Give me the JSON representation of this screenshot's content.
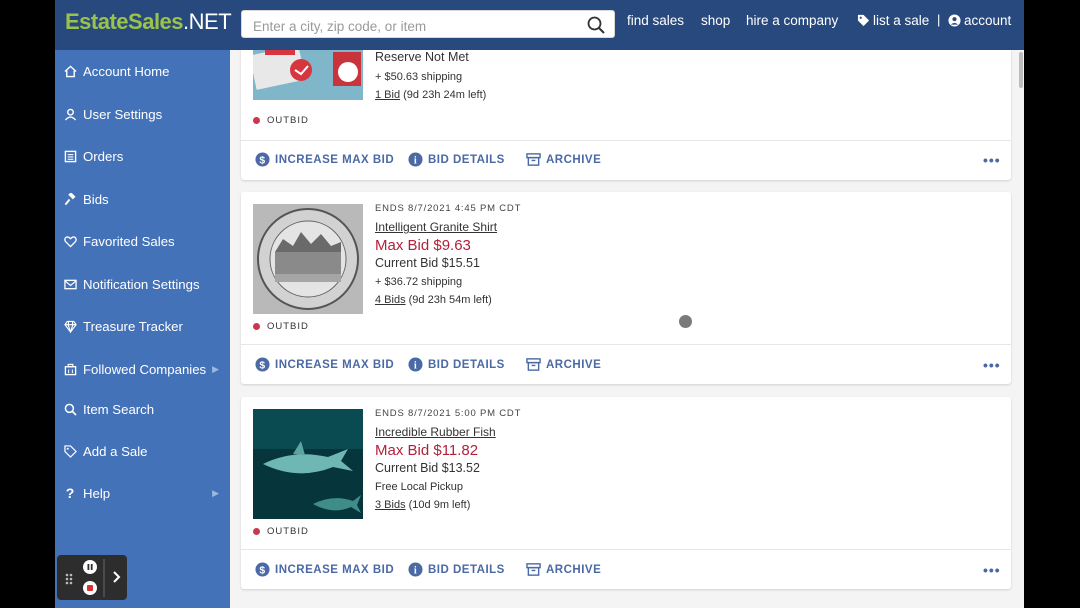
{
  "logo": {
    "part1": "EstateSales",
    "part2": ".NET"
  },
  "search": {
    "placeholder": "Enter a city, zip code, or item"
  },
  "nav": {
    "find_sales": "find sales",
    "shop": "shop",
    "hire": "hire a company",
    "list": "list a sale",
    "sep": "|",
    "account": "account"
  },
  "sidebar": {
    "items": [
      {
        "label": "Account Home",
        "icon": "home-icon"
      },
      {
        "label": "User Settings",
        "icon": "user-icon"
      },
      {
        "label": "Orders",
        "icon": "orders-icon"
      },
      {
        "label": "Bids",
        "icon": "gavel-icon"
      },
      {
        "label": "Favorited Sales",
        "icon": "heart-icon"
      },
      {
        "label": "Notification Settings",
        "icon": "envelope-icon"
      },
      {
        "label": "Treasure Tracker",
        "icon": "diamond-icon"
      },
      {
        "label": "Followed Companies",
        "icon": "building-icon"
      },
      {
        "label": "Item Search",
        "icon": "search-icon"
      },
      {
        "label": "Add a Sale",
        "icon": "tag-icon"
      },
      {
        "label": "Help",
        "icon": "question-icon"
      }
    ]
  },
  "cards": [
    {
      "title": "Reserve Not Met",
      "shipping": "+ $50.63 shipping",
      "bids_link": "1 Bid",
      "bids_time": "(9d 23h 24m left)",
      "status": "OUTBID"
    },
    {
      "ends": "ENDS 8/7/2021 4:45 PM CDT",
      "title": "Intelligent Granite Shirt",
      "max_bid": "Max Bid $9.63",
      "current_bid": "Current Bid $15.51",
      "shipping": "+ $36.72 shipping",
      "bids_link": "4 Bids",
      "bids_time": "(9d 23h 54m left)",
      "status": "OUTBID"
    },
    {
      "ends": "ENDS 8/7/2021 5:00 PM CDT",
      "title": "Incredible Rubber Fish",
      "max_bid": "Max Bid $11.82",
      "current_bid": "Current Bid $13.52",
      "shipping": "Free Local Pickup",
      "bids_link": "3 Bids",
      "bids_time": "(10d 9m left)",
      "status": "OUTBID"
    }
  ],
  "actions": {
    "increase": "INCREASE MAX BID",
    "details": "BID DETAILS",
    "archive": "ARCHIVE",
    "more": "•••"
  },
  "colors": {
    "topbar": "#27497d",
    "sidebar": "#4472b8",
    "logo_green": "#9bc24a",
    "max_bid": "#b2213a",
    "action": "#4a69a5",
    "outbid_dot": "#c8394f"
  }
}
